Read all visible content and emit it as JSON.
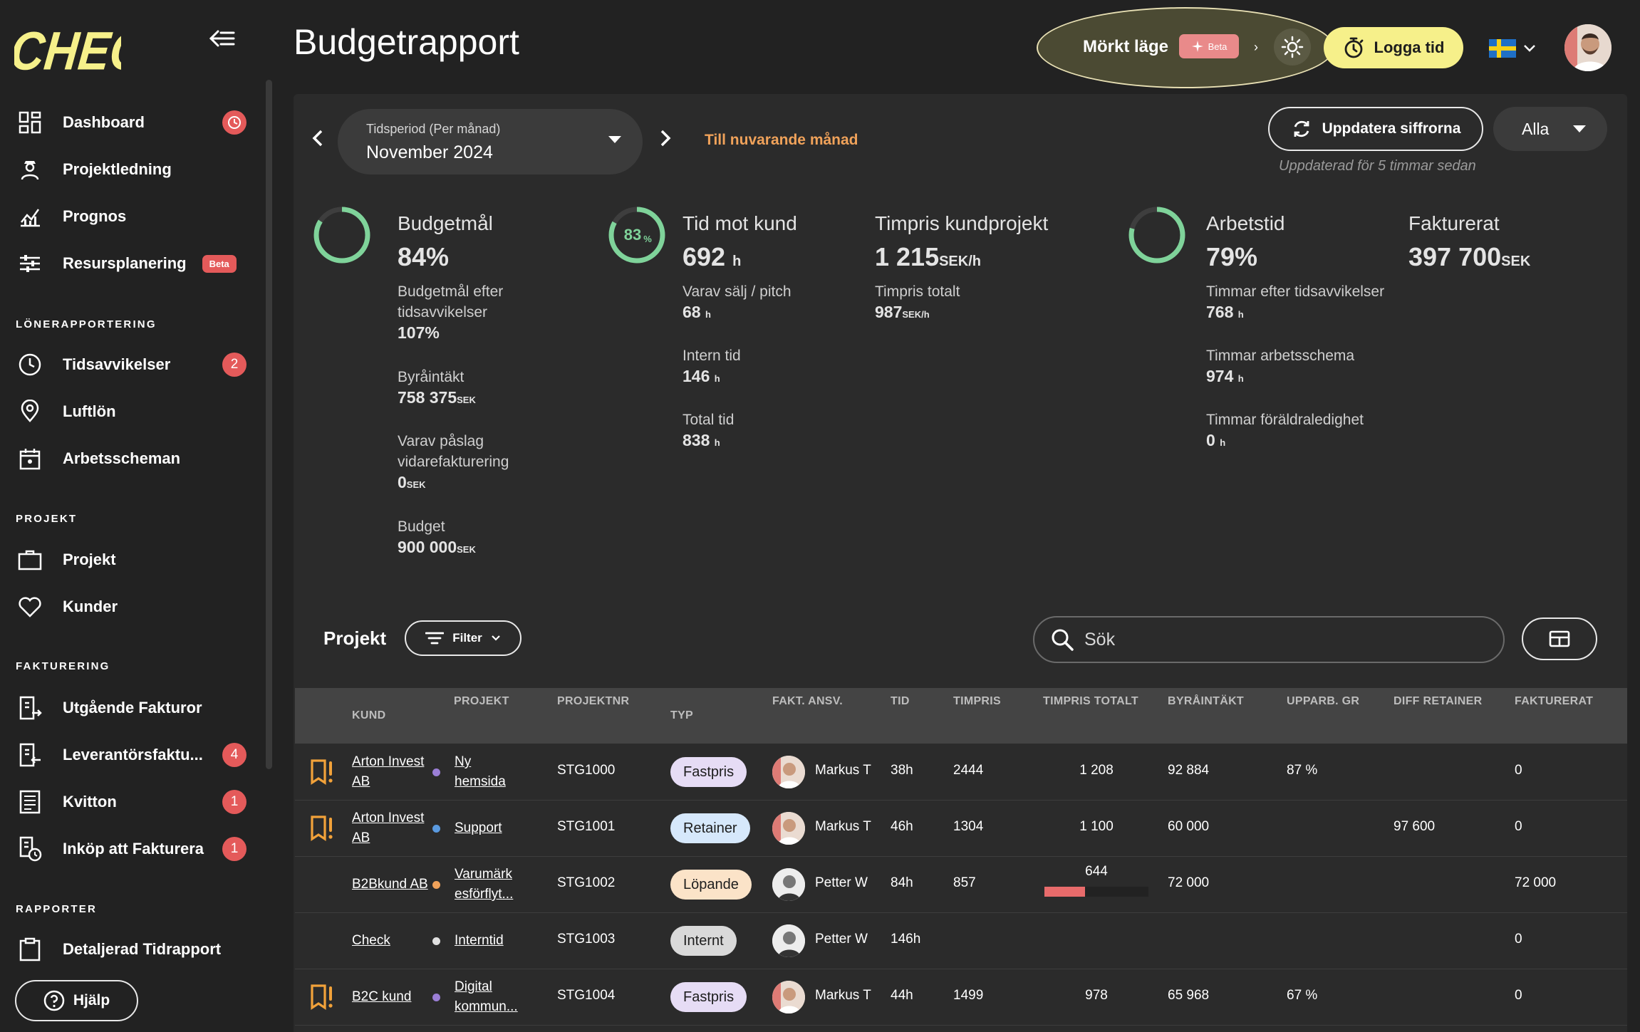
{
  "app": {
    "logo_text": "CHECK",
    "page_title": "Budgetrapport"
  },
  "colors": {
    "accent_yellow": "#f6f08a",
    "accent_orange": "#f0a25a",
    "badge_red": "#e45a5a",
    "ring_green": "#7fd39a",
    "background": "#222222",
    "panel": "#2b2b2b"
  },
  "sidebar": {
    "items": [
      {
        "label": "Dashboard",
        "icon": "dashboard-grid-icon",
        "badge": "clock"
      },
      {
        "label": "Projektledning",
        "icon": "manager-icon"
      },
      {
        "label": "Prognos",
        "icon": "chart-icon"
      },
      {
        "label": "Resursplanering",
        "icon": "sliders-icon",
        "badge_text": "Beta"
      }
    ],
    "sections": [
      {
        "title": "LÖNERAPPORTERING",
        "items": [
          {
            "label": "Tidsavvikelser",
            "icon": "clock-icon",
            "badge": "2"
          },
          {
            "label": "Luftlön",
            "icon": "location-pin-icon"
          },
          {
            "label": "Arbetsscheman",
            "icon": "calendar-icon"
          }
        ]
      },
      {
        "title": "PROJEKT",
        "items": [
          {
            "label": "Projekt",
            "icon": "briefcase-icon"
          },
          {
            "label": "Kunder",
            "icon": "heart-icon"
          }
        ]
      },
      {
        "title": "FAKTURERING",
        "items": [
          {
            "label": "Utgående Fakturor",
            "icon": "invoice-out-icon"
          },
          {
            "label": "Leverantörsfaktu...",
            "icon": "invoice-in-icon",
            "badge": "4"
          },
          {
            "label": "Kvitton",
            "icon": "receipt-icon",
            "badge": "1"
          },
          {
            "label": "Inköp att Fakturera",
            "icon": "purchase-icon",
            "badge": "1"
          }
        ]
      },
      {
        "title": "RAPPORTER",
        "items": [
          {
            "label": "Detaljerad Tidrapport",
            "icon": "clipboard-icon"
          }
        ]
      }
    ],
    "help_label": "Hjälp"
  },
  "header": {
    "dark_mode_label": "Mörkt läge",
    "beta_label": "Beta",
    "log_time_label": "Logga tid",
    "language": "sv"
  },
  "toolbar": {
    "period_caption": "Tidsperiod (Per månad)",
    "period_value": "November 2024",
    "current_month_label": "Till nuvarande månad",
    "update_label": "Uppdatera siffrorna",
    "scope_value": "Alla",
    "updated_text": "Uppdaterad för 5 timmar sedan"
  },
  "kpis": {
    "budget": {
      "title": "Budgetmål",
      "value": "84%",
      "ring_fraction": 0.84,
      "after_label": "Budgetmål efter tidsavvikelser",
      "after_value": "107%",
      "income_label": "Byråintäkt",
      "income_value": "758 375",
      "income_unit": "SEK",
      "markup_label": "Varav påslag vidarefakturering",
      "markup_value": "0",
      "markup_unit": "SEK",
      "budget_label": "Budget",
      "budget_value": "900 000",
      "budget_unit": "SEK"
    },
    "client_time": {
      "ring_label": "83",
      "ring_unit": "%",
      "ring_fraction": 0.83,
      "title": "Tid mot kund",
      "value": "692",
      "unit": "h",
      "sales_label": "Varav sälj / pitch",
      "sales_value": "68",
      "sales_unit": "h",
      "internal_label": "Intern tid",
      "internal_value": "146",
      "internal_unit": "h",
      "total_label": "Total tid",
      "total_value": "838",
      "total_unit": "h"
    },
    "hourly": {
      "title": "Timpris kundprojekt",
      "value": "1 215",
      "unit": "SEK/h",
      "total_label": "Timpris totalt",
      "total_value": "987",
      "total_unit": "SEK/h"
    },
    "worktime": {
      "title": "Arbetstid",
      "value": "79%",
      "ring_fraction": 0.79,
      "after_label": "Timmar efter tidsavvikelser",
      "after_value": "768",
      "after_unit": "h",
      "schedule_label": "Timmar arbetsschema",
      "schedule_value": "974",
      "schedule_unit": "h",
      "parental_label": "Timmar föräldraledighet",
      "parental_value": "0",
      "parental_unit": "h"
    },
    "invoiced": {
      "title": "Fakturerat",
      "value": "397 700",
      "unit": "SEK"
    }
  },
  "projects": {
    "title": "Projekt",
    "filter_label": "Filter",
    "search_placeholder": "Sök",
    "columns": [
      "KUND",
      "PROJEKT",
      "PROJEKTNR",
      "TYP",
      "FAKT. ANSV.",
      "TID",
      "TIMPRIS",
      "TIMPRIS TOTALT",
      "BYRÅINTÄKT",
      "UPPARB. GR",
      "DIFF RETAINER",
      "FAKTURERAT"
    ],
    "rows": [
      {
        "warn": true,
        "kund": [
          "Arton Invest",
          "AB"
        ],
        "projekt": [
          "Ny",
          "hemsida"
        ],
        "dot": "#9b7fd6",
        "nr": "STG1000",
        "typ": "Fastpris",
        "typ_color": "#e6dcf5",
        "ansv": "Markus T",
        "tid": "38h",
        "timpris": "2444",
        "totalt": "1 208",
        "intakt": "92 884",
        "upparb": "87 %",
        "diff": "",
        "fakt": "0"
      },
      {
        "warn": true,
        "kund": [
          "Arton Invest",
          "AB"
        ],
        "projekt": [
          "Support"
        ],
        "dot": "#5a9ae0",
        "nr": "STG1001",
        "typ": "Retainer",
        "typ_color": "#d6e8fb",
        "ansv": "Markus T",
        "tid": "46h",
        "timpris": "1304",
        "totalt": "1 100",
        "intakt": "60 000",
        "upparb": "",
        "diff": "97 600",
        "fakt": "0"
      },
      {
        "warn": false,
        "kund": [
          "B2Bkund AB"
        ],
        "projekt": [
          "Varumärk",
          "esförflyt..."
        ],
        "dot": "#f0a25a",
        "nr": "STG1002",
        "typ": "Löpande",
        "typ_color": "#fbe3c8",
        "ansv": "Petter W",
        "tid": "84h",
        "timpris": "857",
        "totalt": "644",
        "totalt_bar": 0.5,
        "intakt": "72 000",
        "upparb": "",
        "diff": "",
        "fakt": "72 000"
      },
      {
        "warn": false,
        "kund": [
          "Check"
        ],
        "projekt": [
          "Interntid"
        ],
        "dot": "#e0e0e0",
        "nr": "STG1003",
        "typ": "Internt",
        "typ_color": "#d9d9d9",
        "ansv": "Petter W",
        "tid": "146h",
        "timpris": "",
        "totalt": "",
        "intakt": "",
        "upparb": "",
        "diff": "",
        "fakt": "0"
      },
      {
        "warn": true,
        "kund": [
          "B2C kund"
        ],
        "projekt": [
          "Digital",
          "kommun..."
        ],
        "dot": "#9b7fd6",
        "nr": "STG1004",
        "typ": "Fastpris",
        "typ_color": "#e6dcf5",
        "ansv": "Markus T",
        "tid": "44h",
        "timpris": "1499",
        "totalt": "978",
        "intakt": "65 968",
        "upparb": "67 %",
        "diff": "",
        "fakt": "0"
      }
    ]
  }
}
